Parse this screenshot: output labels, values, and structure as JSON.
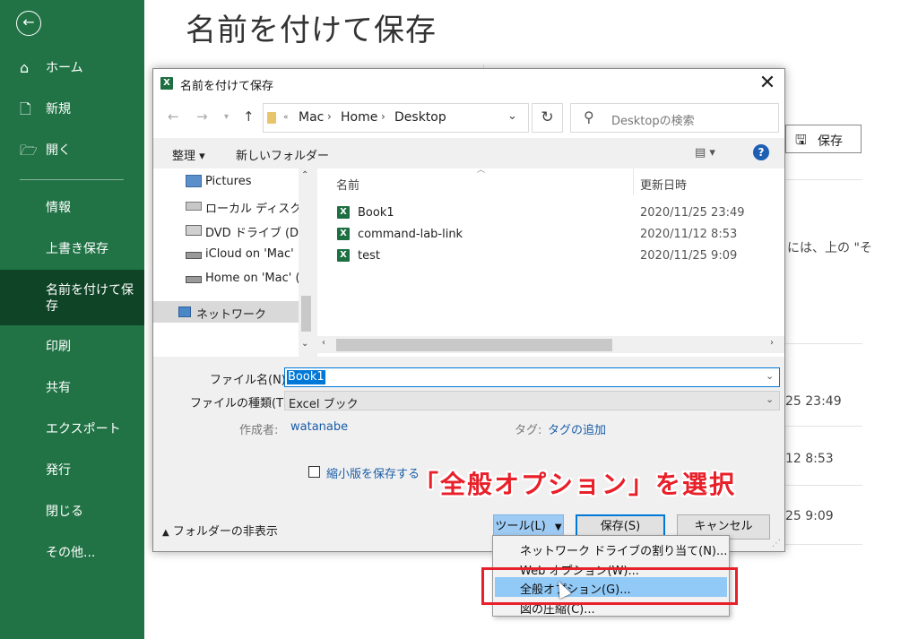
{
  "colors": {
    "excel_green": "#217346",
    "sidebar_active": "#0f4426",
    "accent_blue": "#0078d7",
    "annotation_red": "#e8202a"
  },
  "sidebar": {
    "back_icon": "back-arrow-icon",
    "items": [
      {
        "icon": "home-icon",
        "label": "ホーム"
      },
      {
        "icon": "new-doc-icon",
        "label": "新規"
      },
      {
        "icon": "folder-open-icon",
        "label": "開く"
      },
      {
        "label": "情報"
      },
      {
        "label": "上書き保存"
      },
      {
        "label": "名前を付けて保存",
        "active": true
      },
      {
        "label": "印刷"
      },
      {
        "label": "共有"
      },
      {
        "label": "エクスポート"
      },
      {
        "label": "発行"
      },
      {
        "label": "閉じる"
      },
      {
        "label": "その他..."
      }
    ]
  },
  "backstage": {
    "title": "名前を付けて保存",
    "save_button": "保存",
    "partial_texts": [
      "には、上の \"そ",
      "25 23:49",
      "12 8:53",
      "25 9:09"
    ]
  },
  "dialog": {
    "title": "名前を付けて保存",
    "address": {
      "overflow": "«",
      "crumbs": [
        "Mac",
        "Home",
        "Desktop"
      ]
    },
    "search_placeholder": "Desktopの検索",
    "toolbar": {
      "organize": "整理 ▾",
      "new_folder": "新しいフォルダー",
      "view": "▤ ▾",
      "help": "?"
    },
    "tree": [
      {
        "icon": "pictures-icon",
        "label": "Pictures"
      },
      {
        "icon": "drive-icon",
        "label": "ローカル ディスク (C:"
      },
      {
        "icon": "dvd-icon",
        "label": "DVD ドライブ (D:) ("
      },
      {
        "icon": "network-drive-icon",
        "label": "iCloud on 'Mac' ("
      },
      {
        "icon": "network-drive-icon",
        "label": "Home on 'Mac' ("
      },
      {
        "icon": "network-icon",
        "label": "ネットワーク",
        "selected": true
      }
    ],
    "columns": {
      "name": "名前",
      "modified": "更新日時"
    },
    "files": [
      {
        "icon": "excel-file-icon",
        "name": "Book1",
        "modified": "2020/11/25 23:49"
      },
      {
        "icon": "excel-file-icon",
        "name": "command-lab-link",
        "modified": "2020/11/12 8:53"
      },
      {
        "icon": "excel-file-icon",
        "name": "test",
        "modified": "2020/11/25 9:09"
      }
    ],
    "file_name_label": "ファイル名(N):",
    "file_name_value": "Book1",
    "file_type_label": "ファイルの種類(T):",
    "file_type_value": "Excel ブック",
    "author_label": "作成者:",
    "author_value": "watanabe",
    "tags_label": "タグ:",
    "tags_value": "タグの追加",
    "thumbnail_label": "縮小版を保存する",
    "thumbnail_checked": false,
    "hide_folders": "フォルダーの非表示",
    "tools_button": "ツール(L)",
    "save_button": "保存(S)",
    "cancel_button": "キャンセル"
  },
  "tools_menu": {
    "items": [
      {
        "label": "ネットワーク ドライブの割り当て(N)..."
      },
      {
        "label": "Web オプション(W)..."
      },
      {
        "label": "全般オプション(G)...",
        "highlighted": true
      },
      {
        "label": "図の圧縮(C)..."
      }
    ]
  },
  "annotation": {
    "callout": "「全般オプション」を選択"
  }
}
